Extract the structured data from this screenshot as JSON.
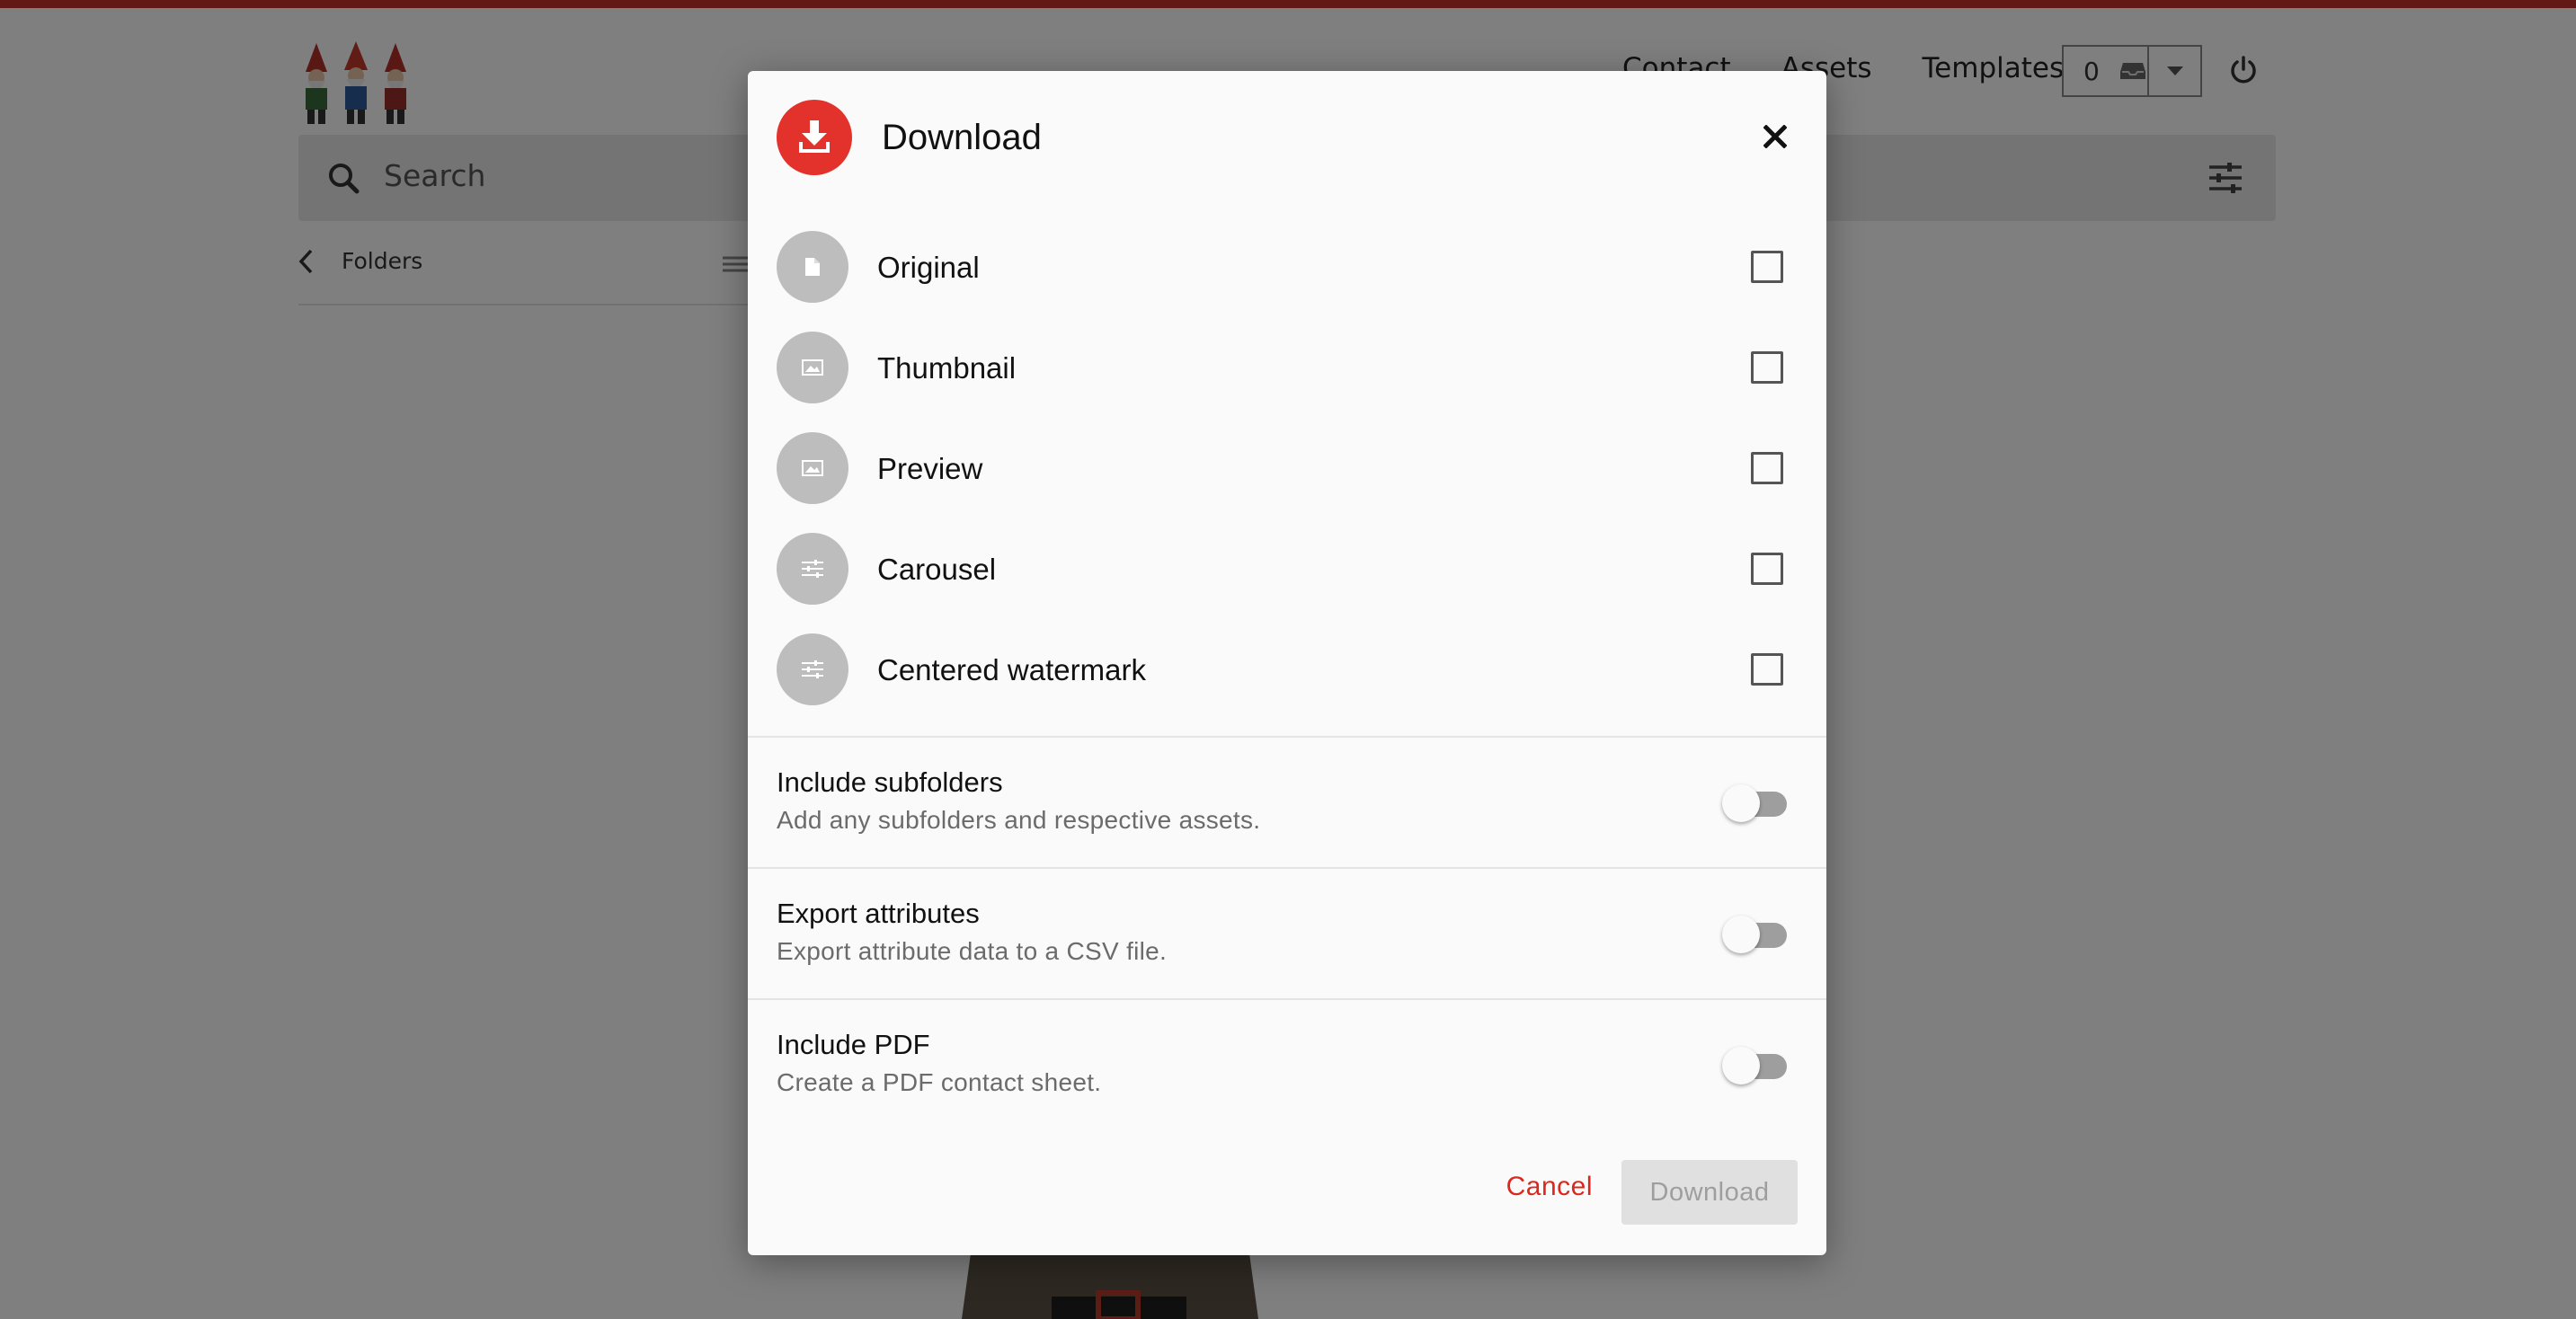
{
  "app": {
    "nav": [
      "Contact",
      "Assets",
      "Templates"
    ],
    "cart_count": "0",
    "search_placeholder": "Search",
    "breadcrumb": "Folders",
    "accent_color": "#c4302b"
  },
  "dialog": {
    "title": "Download",
    "badge_color": "#e3322b",
    "options": [
      {
        "label": "Original",
        "icon": "document-icon",
        "checked": false
      },
      {
        "label": "Thumbnail",
        "icon": "image-icon",
        "checked": false
      },
      {
        "label": "Preview",
        "icon": "image-icon",
        "checked": false
      },
      {
        "label": "Carousel",
        "icon": "sliders-icon",
        "checked": false
      },
      {
        "label": "Centered watermark",
        "icon": "sliders-icon",
        "checked": false
      }
    ],
    "toggles": [
      {
        "title": "Include subfolders",
        "desc": "Add any subfolders and respective assets.",
        "on": false
      },
      {
        "title": "Export attributes",
        "desc": "Export attribute data to a CSV file.",
        "on": false
      },
      {
        "title": "Include PDF",
        "desc": "Create a PDF contact sheet.",
        "on": false
      }
    ],
    "cancel_label": "Cancel",
    "download_label": "Download",
    "cancel_color": "#d9291f"
  }
}
